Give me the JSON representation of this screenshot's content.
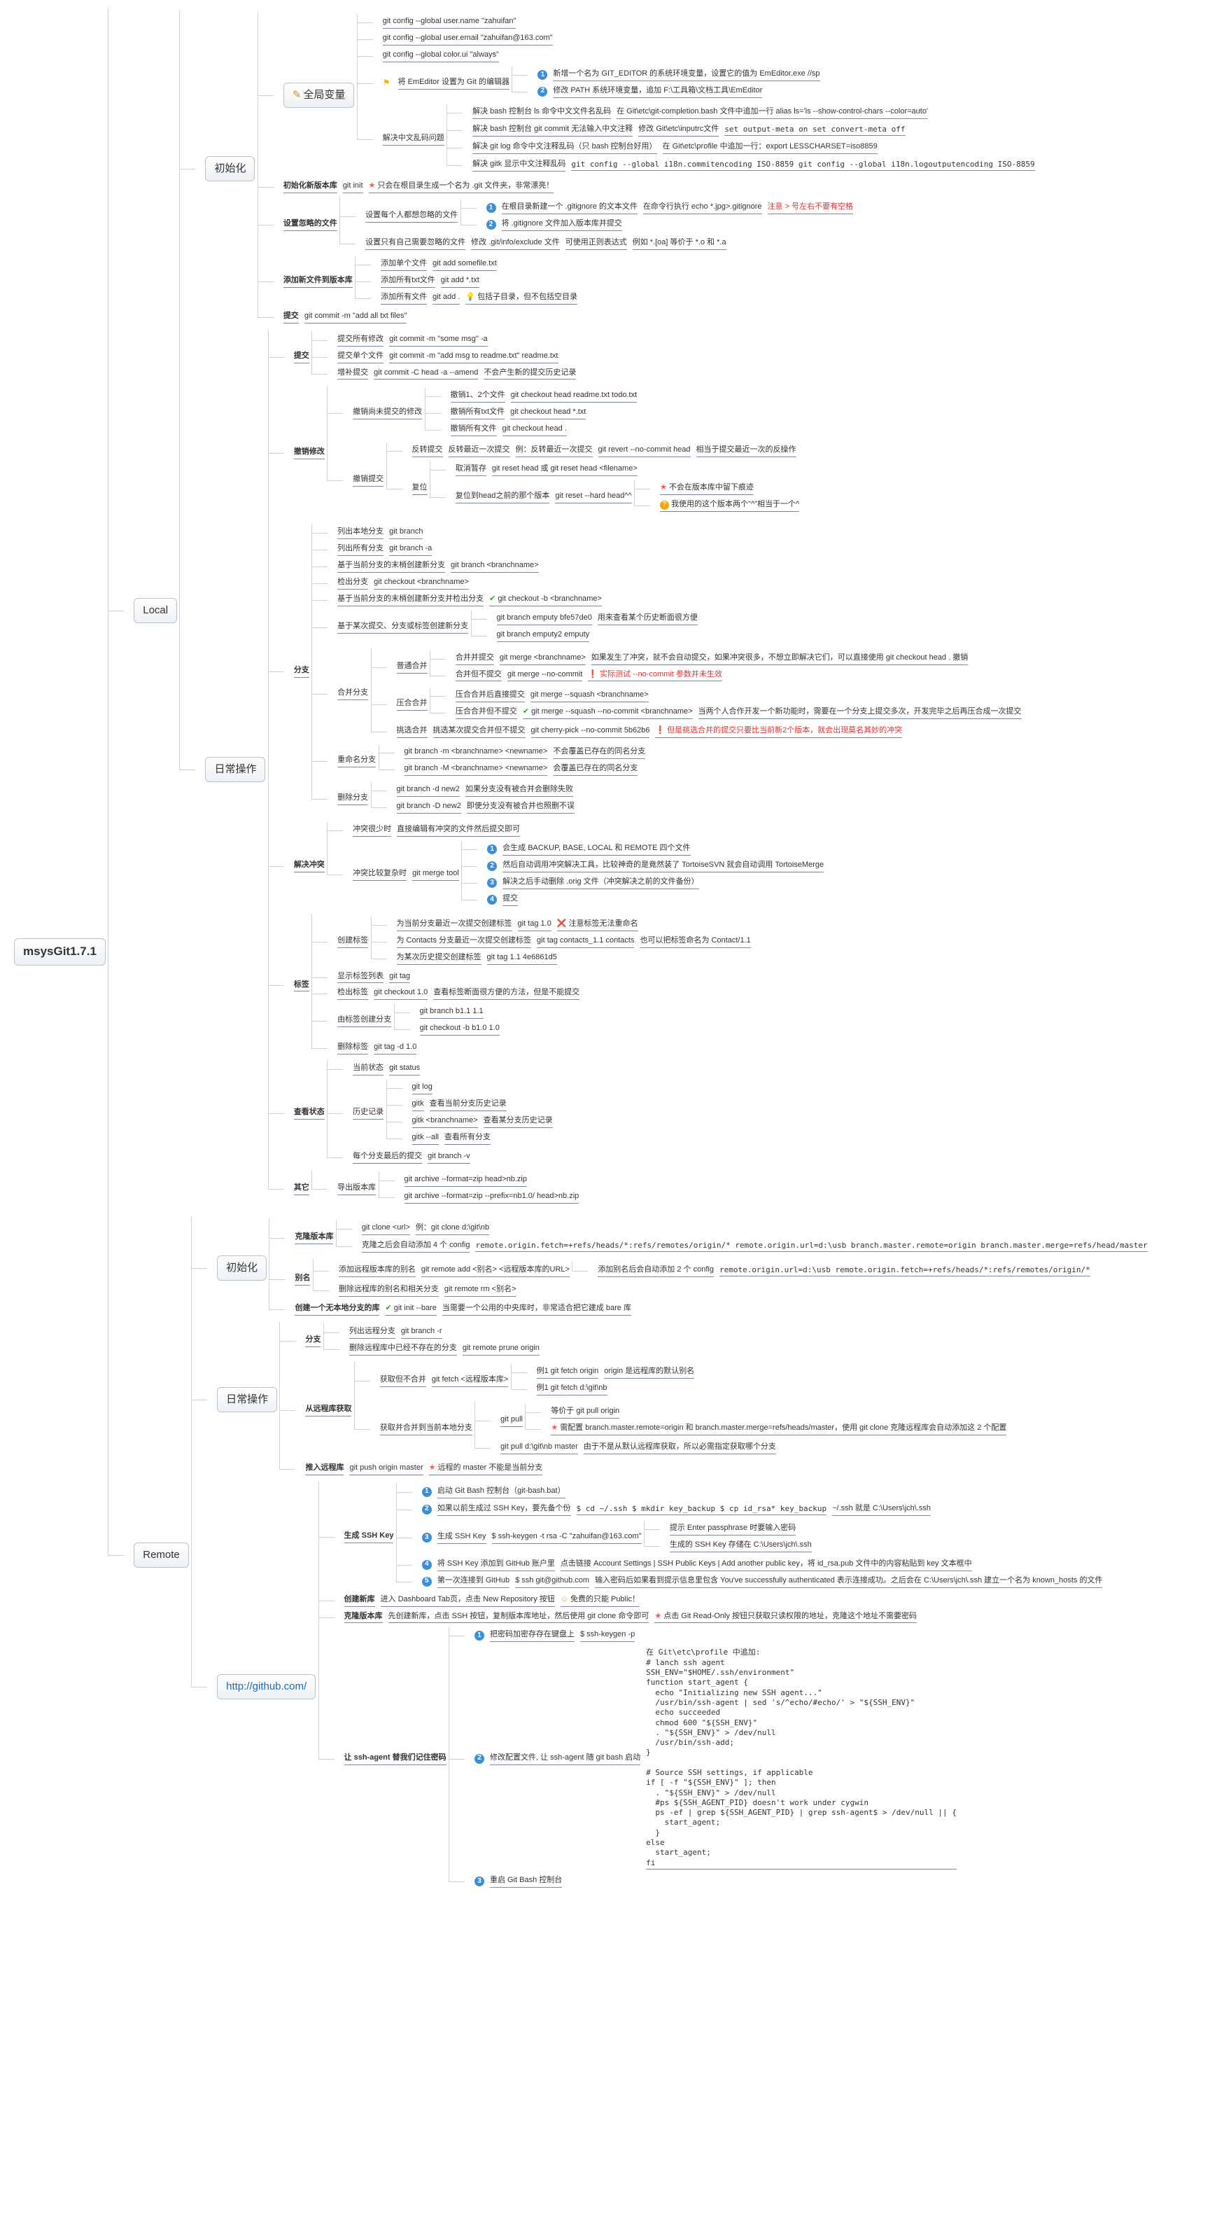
{
  "root": "msysGit1.7.1",
  "n": {
    "local": "Local",
    "remote": "Remote",
    "init": "初始化",
    "daily": "日常操作",
    "github": "http://github.com/",
    "global": "全局变量",
    "chs": "解决中文乱码问题",
    "g1": "git config --global user.name \"zahuifan\"",
    "g2": "git config --global user.email \"zahuifan@163.com\"",
    "g3": "git config --global color.ui \"always\"",
    "g4a": "将 EmEditor 设置为 Git 的编辑器",
    "g4_1": "新增一个名为 GIT_EDITOR 的系统环境变量，设置它的值为 EmEditor.exe //sp",
    "g4_2": "修改 PATH 系统环境变量，追加 F:\\工具箱\\文档工具\\EmEditor",
    "chs1": "解决 bash 控制台 ls 命令中文文件名乱码",
    "chs1b": "在 Git\\etc\\git-completion.bash 文件中追加一行 alias ls='ls --show-control-chars --color=auto'",
    "chs2": "解决 bash 控制台 git commit 无法输入中文注释",
    "chs2b": "修改 Git\\etc\\inputrc文件",
    "chs2c": "set output-meta on\nset convert-meta off",
    "chs3": "解决 git log 命令中文注释乱码（只 bash 控制台好用）",
    "chs3b": "在 Git\\etc\\profile 中追加一行：export LESSCHARSET=iso8859",
    "chs4": "解决 gitk 显示中文注释乱码",
    "chs4b": "git config --global i18n.commitencoding ISO-8859\ngit config --global i18n.logoutputencoding ISO-8859",
    "initRepo": "初始化新版本库",
    "initCmd": "git init",
    "initNote": "只会在根目录生成一个名为 .git 文件夹，非常漂亮！",
    "ignore": "设置忽略的文件",
    "ignA": "设置每个人都想忽略的文件",
    "ignA1": "在根目录新建一个 .gitignore 的文本文件",
    "ignA1b": "在命令行执行 echo *.jpg>.gitignore",
    "ignA1c": "注意 > 号左右不要有空格",
    "ignA2": "将 .gitignore 文件加入版本库并提交",
    "ignB": "设置只有自己需要忽略的文件",
    "ignBb": "修改 .git/info/exclude 文件",
    "ignBc": "可使用正则表达式",
    "ignBd": "例如 *.[oa] 等价于 *.o 和 *.a",
    "addNew": "添加新文件到版本库",
    "add1": "添加单个文件",
    "add1c": "git add somefile.txt",
    "add2": "添加所有txt文件",
    "add2c": "git add *.txt",
    "add3": "添加所有文件",
    "add3c": "git add .",
    "add3d": "包括子目录，但不包括空目录",
    "commit": "提交",
    "commitCmd": "git commit -m \"add all txt files\"",
    "commitGrp": "提交",
    "c1": "提交所有修改",
    "c1c": "git commit -m \"some msg\" -a",
    "c2": "提交单个文件",
    "c2c": "git commit -m \"add msg to readme.txt\" readme.txt",
    "c3": "增补提交",
    "c3c": "git commit -C head -a --amend",
    "c3d": "不会产生新的提交历史记录",
    "undo": "撤销修改",
    "u1": "撤销尚未提交的修改",
    "u1a": "撤销1、2个文件",
    "u1ac": "git checkout head readme.txt todo.txt",
    "u1b": "撤销所有txt文件",
    "u1bc": "git checkout head *.txt",
    "u1c": "撤销所有文件",
    "u1cc": "git checkout head .",
    "u2": "撤销提交",
    "u2a": "反转提交",
    "u2aa": "反转最近一次提交",
    "u2ab": "例：反转最近一次提交",
    "u2ac": "git revert --no-commit head",
    "u2ad": "相当于提交最近一次的反操作",
    "u2b": "复位",
    "u2b1": "取消暂存",
    "u2b1c": "git reset head 或 git reset head <filename>",
    "u2b2": "复位到head之前的那个版本",
    "u2b2c": "git reset --hard head^^",
    "u2b2d": "不会在版本库中留下痕迹",
    "u2b2e": "我使用的这个版本两个\"^\"相当于一个^",
    "branch": "分支",
    "b1": "列出本地分支",
    "b1c": "git branch",
    "b2": "列出所有分支",
    "b2c": "git branch -a",
    "b3": "基于当前分支的末梢创建新分支",
    "b3c": "git branch <branchname>",
    "b4": "检出分支",
    "b4c": "git checkout <branchname>",
    "b5": "基于当前分支的末梢创建新分支并检出分支",
    "b5c": "git checkout -b <branchname>",
    "b6": "基于某次提交、分支或标签创建新分支",
    "b6a": "git branch emputy bfe57de0",
    "b6an": "用来查看某个历史断面很方便",
    "b6b": "git branch emputy2 emputy",
    "merge": "合并分支",
    "m1": "普通合并",
    "m1a": "合并并提交",
    "m1ac": "git merge <branchname>",
    "m1an": "如果发生了冲突，就不会自动提交，如果冲突很多，不想立即解决它们，可以直接使用 git checkout head . 撤销",
    "m1b": "合并但不提交",
    "m1bc": "git merge --no-commit",
    "m1bn": "实际测试 --no-commit 参数并未生效",
    "m2": "压合合并",
    "m2a": "压合合并后直接提交",
    "m2ac": "git merge --squash <branchname>",
    "m2b": "压合合并但不提交",
    "m2bc": "git merge --squash --no-commit <branchname>",
    "m2bn": "当两个人合作开发一个新功能时，需要在一个分支上提交多次，开发完毕之后再压合成一次提交",
    "m3": "挑选合并",
    "m3a": "挑选某次提交合并但不提交",
    "m3ac": "git cherry-pick --no-commit 5b62b6",
    "m3an": "但是挑选合并的提交只要比当前新2个版本，就会出现莫名其妙的冲突",
    "rename": "重命名分支",
    "rn1": "git branch -m <branchname> <newname>",
    "rn1n": "不会覆盖已存在的同名分支",
    "rn2": "git branch -M <branchname> <newname>",
    "rn2n": "会覆盖已存在的同名分支",
    "del": "删除分支",
    "del1": "git branch -d new2",
    "del1n": "如果分支没有被合并会删除失败",
    "del2": "git branch -D new2",
    "del2n": "即使分支没有被合并也照删不误",
    "conflict": "解决冲突",
    "cf1": "冲突很少时",
    "cf1n": "直接编辑有冲突的文件然后提交即可",
    "cf2": "冲突比较复杂时",
    "cf2c": "git merge tool",
    "cf2_1": "会生成 BACKUP, BASE, LOCAL 和 REMOTE 四个文件",
    "cf2_2": "然后自动调用冲突解决工具，比较神奇的是竟然装了 TortoiseSVN 就会自动调用  TortoiseMerge",
    "cf2_3": "解决之后手动删除 .orig 文件（冲突解决之前的文件备份）",
    "cf2_4": "提交",
    "tag": "标签",
    "t1": "创建标签",
    "t1a": "为当前分支最近一次提交创建标签",
    "t1ac": "git tag 1.0",
    "t1an": "注意标签无法重命名",
    "t1b": "为 Contacts 分支最近一次提交创建标签",
    "t1bc": "git tag contacts_1.1 contacts",
    "t1bn": "也可以把标签命名为 Contact/1.1",
    "t1c": "为某次历史提交创建标签",
    "t1cc": "git tag 1.1 4e6861d5",
    "t2": "显示标签列表",
    "t2c": "git tag",
    "t3": "检出标签",
    "t3c": "git checkout 1.0",
    "t3n": "查看标签断面很方便的方法，但是不能提交",
    "t4": "由标签创建分支",
    "t4a": "git branch b1.1 1.1",
    "t4b": "git checkout -b b1.0 1.0",
    "t5": "删除标签",
    "t5c": "git tag -d 1.0",
    "status": "查看状态",
    "s1": "当前状态",
    "s1c": "git status",
    "s2": "历史记录",
    "s2a": "git log",
    "s2b1": "gitk",
    "s2b1n": "查看当前分支历史记录",
    "s2b2": "gitk <branchname>",
    "s2b2n": "查看某分支历史记录",
    "s2b3": "gitk --all",
    "s2b3n": "查看所有分支",
    "s3": "每个分支最后的提交",
    "s3c": "git branch -v",
    "other": "其它",
    "o1": "导出版本库",
    "o1a": "git archive --format=zip head>nb.zip",
    "o1b": "git archive --format=zip --prefix=nb1.0/ head>nb.zip",
    "rclone": "克隆版本库",
    "rc1": "git clone <url>",
    "rc1e": "例：git clone d:\\git\\nb",
    "rc2": "克隆之后会自动添加 4 个 config",
    "rc2t": "remote.origin.fetch=+refs/heads/*:refs/remotes/origin/*\nremote.origin.url=d:\\usb\nbranch.master.remote=origin\nbranch.master.merge=refs/head/master",
    "ralias": "别名",
    "ra1": "添加远程版本库的别名",
    "ra1c": "git remote add <别名> <远程版本库的URL>",
    "ra1b": "添加别名后会自动添加 2 个 config",
    "ra1t": "remote.origin.url=d:\\usb\nremote.origin.fetch=+refs/heads/*:refs/remotes/origin/*",
    "ra2": "删除远程库的别名和相关分支",
    "ra2c": "git remote rm <别名>",
    "rbare": "创建一个无本地分支的库",
    "rbarec": "git init --bare",
    "rbaren": "当需要一个公用的中央库时，非常适合把它建成 bare 库",
    "rbranch": "分支",
    "rb1": "列出远程分支",
    "rb1c": "git branch -r",
    "rb2": "删除远程库中已经不存在的分支",
    "rb2c": "git remote prune origin",
    "rfetch": "从远程库获取",
    "rf1": "获取但不合并",
    "rf1c": "git fetch <远程版本库>",
    "rf1e1": "例1 git fetch origin",
    "rf1e1n": "origin 是远程库的默认别名",
    "rf1e2": "例1 git fetch d:\\git\\nb",
    "rf2": "获取并合并到当前本地分支",
    "rf2c": "git pull",
    "rf2_1": "等价于 git pull origin",
    "rf2_2": "需配置  branch.master.remote=origin  和 branch.master.merge=refs/heads/master，使用 git clone 克隆远程库会自动添加这 2 个配置",
    "rf2b": "git pull d:\\git\\nb master",
    "rf2bn": "由于不是从默认远程库获取，所以必需指定获取哪个分支",
    "rpush": "推入远程库",
    "rpushc": "git push origin master",
    "rpushn": "远程的 master 不能是当前分支",
    "ssh": "生成 SSH Key",
    "ssh1": "启动 Git Bash 控制台（git-bash.bat）",
    "ssh2": "如果以前生成过 SSH Key，要先备个份",
    "ssh2c": "$ cd ~/.ssh\n$ mkdir key_backup\n$ cp id_rsa* key_backup",
    "ssh2n": "~/.ssh 就是 C:\\Users\\jch\\.ssh",
    "ssh3": "生成 SSH Key",
    "ssh3c": "$ ssh-keygen -t rsa -C \"zahuifan@163.com\"",
    "ssh3n1": "提示 Enter passphrase 时要输入密码",
    "ssh3n2": "生成的 SSH Key 存储在 C:\\Users\\jch\\.ssh",
    "ssh4": "将 SSH Key 添加到 GitHub 账户里",
    "ssh4n": "点击链接 Account Settings | SSH Public Keys | Add another public key，将 id_rsa.pub 文件中的内容粘贴到 key 文本框中",
    "ssh5": "第一次连接到 GitHub",
    "ssh5c": "$ ssh git@github.com",
    "ssh5n": "输入密码后如果看到提示信息里包含 You've successfully authenticated 表示连接成功。之后会在 C:\\Users\\jch\\.ssh 建立一个名为 known_hosts 的文件",
    "newrepo": "创建新库",
    "nr1": "进入 Dashboard Tab页，点击 New Repository 按钮",
    "nr1n": "免费的只能 Public！",
    "nrclone": "克隆版本库",
    "nrc1": "先创建新库，点击 SSH 按钮，复制版本库地址，然后使用 git clone 命令即可",
    "nrc1n": "点击 Git Read-Only 按钮只获取只读权限的地址，克隆这个地址不需要密码",
    "sshagent": "让 ssh-agent 替我们记住密码",
    "sa1": "把密码加密存存在键盘上",
    "sa1c": "$ ssh-keygen -p",
    "sa2": "修改配置文件, 让 ssh-agent 随 git bash 启动",
    "sa2code": "在 Git\\etc\\profile 中追加:\n# lanch ssh agent\nSSH_ENV=\"$HOME/.ssh/environment\"\nfunction start_agent {\n  echo \"Initializing new SSH agent...\"\n  /usr/bin/ssh-agent | sed 's/^echo/#echo/' > \"${SSH_ENV}\"\n  echo succeeded\n  chmod 600 \"${SSH_ENV}\"\n  . \"${SSH_ENV}\" > /dev/null\n  /usr/bin/ssh-add;\n}\n\n# Source SSH settings, if applicable\nif [ -f \"${SSH_ENV}\" ]; then\n  . \"${SSH_ENV}\" > /dev/null\n  #ps ${SSH_AGENT_PID} doesn't work under cygwin\n  ps -ef | grep ${SSH_AGENT_PID} | grep ssh-agent$ > /dev/null || {\n    start_agent;\n  }\nelse\n  start_agent;\nfi",
    "sa3": "重启 Git Bash 控制台"
  }
}
